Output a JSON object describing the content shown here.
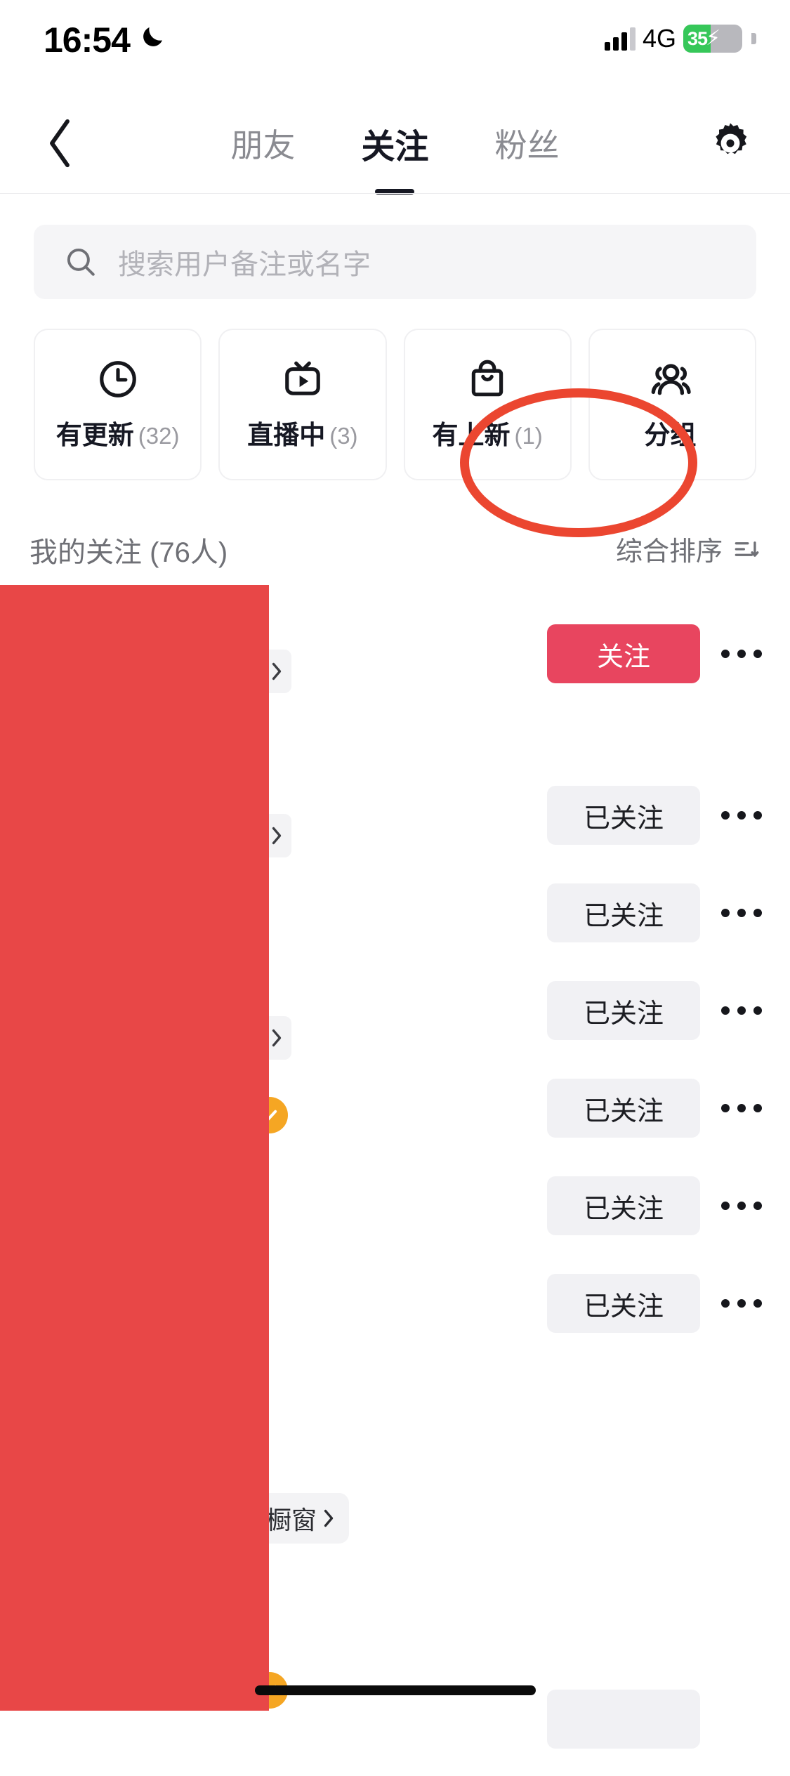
{
  "status_bar": {
    "time": "16:54",
    "moon_icon": "crescent-moon-icon",
    "signal_icon": "cellular-signal-icon",
    "network": "4G",
    "battery_percent": "35",
    "battery_charging_icon": "lightning-bolt-icon",
    "battery_fill_color": "#36c759"
  },
  "header": {
    "back_icon": "chevron-left-icon",
    "settings_icon": "gear-icon",
    "tabs": [
      {
        "label": "朋友",
        "active": false
      },
      {
        "label": "关注",
        "active": true
      },
      {
        "label": "粉丝",
        "active": false
      }
    ]
  },
  "search": {
    "icon": "search-icon",
    "placeholder": "搜索用户备注或名字",
    "value": ""
  },
  "filters": [
    {
      "icon": "clock-icon",
      "label": "有更新",
      "count": "(32)"
    },
    {
      "icon": "live-tv-icon",
      "label": "直播中",
      "count": "(3)"
    },
    {
      "icon": "shopping-bag-icon",
      "label": "有上新",
      "count": "(1)"
    },
    {
      "icon": "group-people-icon",
      "label": "分组",
      "count": ""
    }
  ],
  "section": {
    "title": "我的关注 (76人)",
    "sort_label": "综合排序",
    "sort_icon": "sort-icon"
  },
  "list": {
    "rows": [
      {
        "action_label": "关注",
        "action_state": "follow",
        "menu_icon": "more-dots-icon",
        "badge": "chevron-right-icon"
      },
      {
        "action_label": "已关注",
        "action_state": "following",
        "menu_icon": "more-dots-icon",
        "badge": "chevron-right-icon"
      },
      {
        "action_label": "已关注",
        "action_state": "following",
        "menu_icon": "more-dots-icon",
        "badge": ""
      },
      {
        "action_label": "已关注",
        "action_state": "following",
        "menu_icon": "more-dots-icon",
        "badge": "chevron-right-icon"
      },
      {
        "action_label": "已关注",
        "action_state": "following",
        "menu_icon": "more-dots-icon",
        "badge": "verified-check-icon"
      },
      {
        "action_label": "已关注",
        "action_state": "following",
        "menu_icon": "more-dots-icon",
        "badge": ""
      },
      {
        "action_label": "已关注",
        "action_state": "following",
        "menu_icon": "more-dots-icon",
        "badge": "shop-window"
      }
    ],
    "shop_badge_label": "橱窗",
    "shop_badge_icon": "chevron-right-icon"
  },
  "annotation": {
    "type": "ellipse-highlight",
    "color": "#eb4630",
    "target": "关注"
  },
  "redaction": {
    "color": "#e84747"
  },
  "colors": {
    "accent_follow": "#e8455f",
    "text_primary": "#161823",
    "text_secondary": "#8a8b91",
    "chip_bg": "#f1f1f4"
  }
}
